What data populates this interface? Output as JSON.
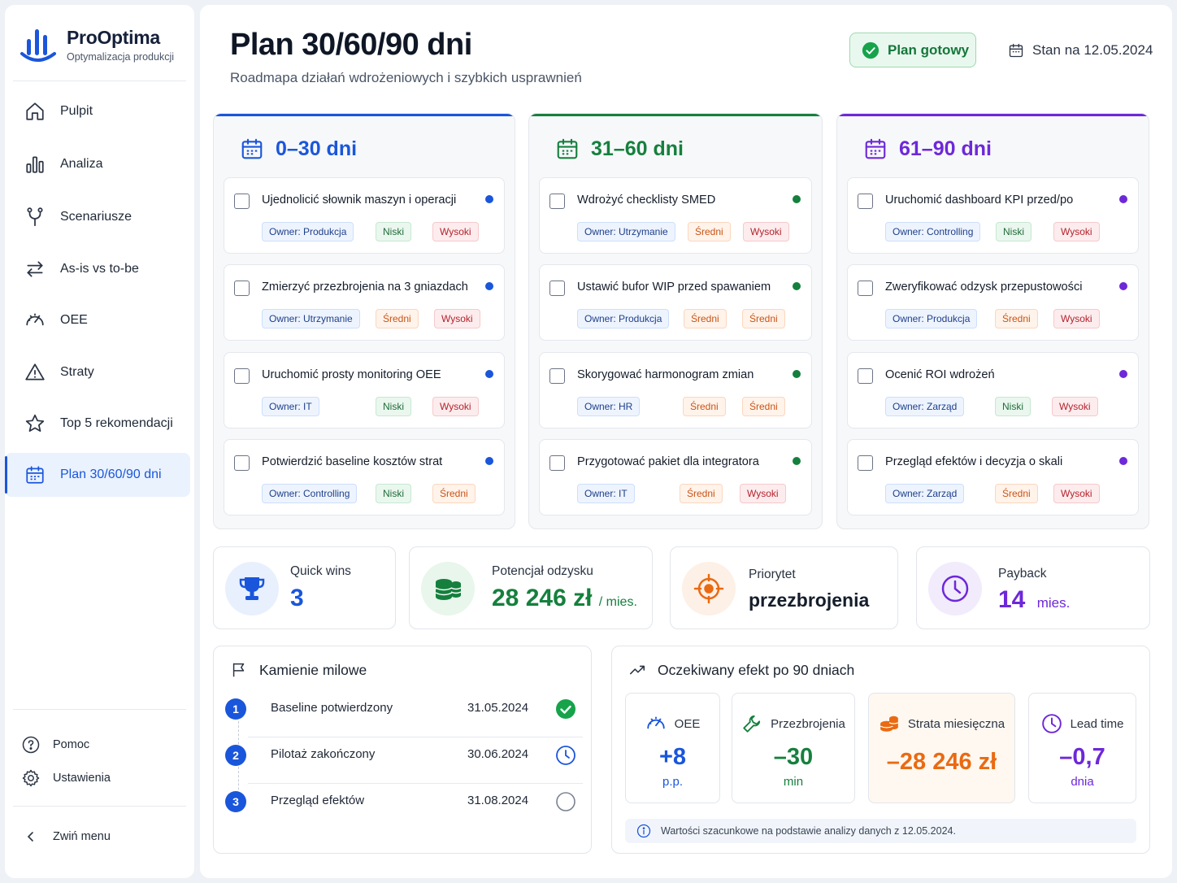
{
  "brand": {
    "name": "ProOptima",
    "subtitle": "Optymalizacja produkcji"
  },
  "colors": {
    "blue": "#1a56db",
    "green": "#15803d",
    "purple": "#6d28d9",
    "orange": "#ea6a12"
  },
  "nav": [
    {
      "label": "Pulpit",
      "icon": "home-icon"
    },
    {
      "label": "Analiza",
      "icon": "bar-chart-icon"
    },
    {
      "label": "Scenariusze",
      "icon": "branch-icon"
    },
    {
      "label": "As-is vs to-be",
      "icon": "swap-arrows-icon"
    },
    {
      "label": "OEE",
      "icon": "gauge-icon"
    },
    {
      "label": "Straty",
      "icon": "warning-icon"
    },
    {
      "label": "Top 5 rekomendacji",
      "icon": "star-icon"
    },
    {
      "label": "Plan 30/60/90 dni",
      "icon": "calendar-icon",
      "active": true
    }
  ],
  "footer": {
    "help": "Pomoc",
    "settings": "Ustawienia",
    "collapse": "Zwiń menu"
  },
  "header": {
    "title": "Plan 30/60/90 dni",
    "subtitle": "Roadmapa działań wdrożeniowych i szybkich usprawnień",
    "badge": "Plan gotowy",
    "date": "Stan na 12.05.2024"
  },
  "columns": [
    {
      "title": "0–30 dni",
      "accent": "#1a56db",
      "tasks": [
        {
          "title": "Ujednolicić słownik maszyn i operacji",
          "owner": "Owner: Produkcja",
          "c1": "Niski",
          "c1t": "niski",
          "c2": "Wysoki",
          "c2t": "wysoki"
        },
        {
          "title": "Zmierzyć przezbrojenia na 3 gniazdach",
          "owner": "Owner: Utrzymanie",
          "c1": "Średni",
          "c1t": "sredni",
          "c2": "Wysoki",
          "c2t": "wysoki"
        },
        {
          "title": "Uruchomić prosty monitoring OEE",
          "owner": "Owner: IT",
          "c1": "Niski",
          "c1t": "niski",
          "c2": "Wysoki",
          "c2t": "wysoki"
        },
        {
          "title": "Potwierdzić baseline kosztów strat",
          "owner": "Owner: Controlling",
          "c1": "Niski",
          "c1t": "niski",
          "c2": "Średni",
          "c2t": "sredni"
        }
      ]
    },
    {
      "title": "31–60 dni",
      "accent": "#15803d",
      "tasks": [
        {
          "title": "Wdrożyć checklisty SMED",
          "owner": "Owner: Utrzymanie",
          "c1": "Średni",
          "c1t": "sredni",
          "c2": "Wysoki",
          "c2t": "wysoki"
        },
        {
          "title": "Ustawić bufor WIP przed spawaniem",
          "owner": "Owner: Produkcja",
          "c1": "Średni",
          "c1t": "sredni",
          "c2": "Średni",
          "c2t": "sredni"
        },
        {
          "title": "Skorygować harmonogram zmian",
          "owner": "Owner: HR",
          "c1": "Średni",
          "c1t": "sredni",
          "c2": "Średni",
          "c2t": "sredni"
        },
        {
          "title": "Przygotować pakiet dla integratora",
          "owner": "Owner: IT",
          "c1": "Średni",
          "c1t": "sredni",
          "c2": "Wysoki",
          "c2t": "wysoki"
        }
      ]
    },
    {
      "title": "61–90 dni",
      "accent": "#6d28d9",
      "tasks": [
        {
          "title": "Uruchomić dashboard KPI przed/po",
          "owner": "Owner: Controlling",
          "c1": "Niski",
          "c1t": "niski",
          "c2": "Wysoki",
          "c2t": "wysoki"
        },
        {
          "title": "Zweryfikować odzysk przepustowości",
          "owner": "Owner: Produkcja",
          "c1": "Średni",
          "c1t": "sredni",
          "c2": "Wysoki",
          "c2t": "wysoki"
        },
        {
          "title": "Ocenić ROI wdrożeń",
          "owner": "Owner: Zarząd",
          "c1": "Niski",
          "c1t": "niski",
          "c2": "Wysoki",
          "c2t": "wysoki"
        },
        {
          "title": "Przegląd efektów i decyzja o skali",
          "owner": "Owner: Zarząd",
          "c1": "Średni",
          "c1t": "sredni",
          "c2": "Wysoki",
          "c2t": "wysoki"
        }
      ]
    }
  ],
  "kpis": {
    "quick_wins": {
      "label": "Quick wins",
      "value": "3"
    },
    "potential": {
      "label": "Potencjał odzysku",
      "value": "28 246 zł",
      "unit": "/ mies."
    },
    "priority": {
      "label": "Priorytet",
      "value": "przezbrojenia"
    },
    "payback": {
      "label": "Payback",
      "value": "14",
      "unit": "mies."
    }
  },
  "milestones": {
    "title": "Kamienie milowe",
    "items": [
      {
        "num": "1",
        "name": "Baseline potwierdzony",
        "date": "31.05.2024",
        "status": "done"
      },
      {
        "num": "2",
        "name": "Pilotaż zakończony",
        "date": "30.06.2024",
        "status": "pending"
      },
      {
        "num": "3",
        "name": "Przegląd efektów",
        "date": "31.08.2024",
        "status": "open"
      }
    ]
  },
  "effect": {
    "title": "Oczekiwany efekt po 90 dniach",
    "items": [
      {
        "label": "OEE",
        "value": "+8",
        "unit": "p.p."
      },
      {
        "label": "Przezbrojenia",
        "value": "–30",
        "unit": "min"
      },
      {
        "label": "Strata miesięczna",
        "value": "–28 246 zł",
        "unit": ""
      },
      {
        "label": "Lead time",
        "value": "–0,7",
        "unit": "dnia"
      }
    ],
    "note": "Wartości szacunkowe na podstawie analizy danych z 12.05.2024."
  }
}
